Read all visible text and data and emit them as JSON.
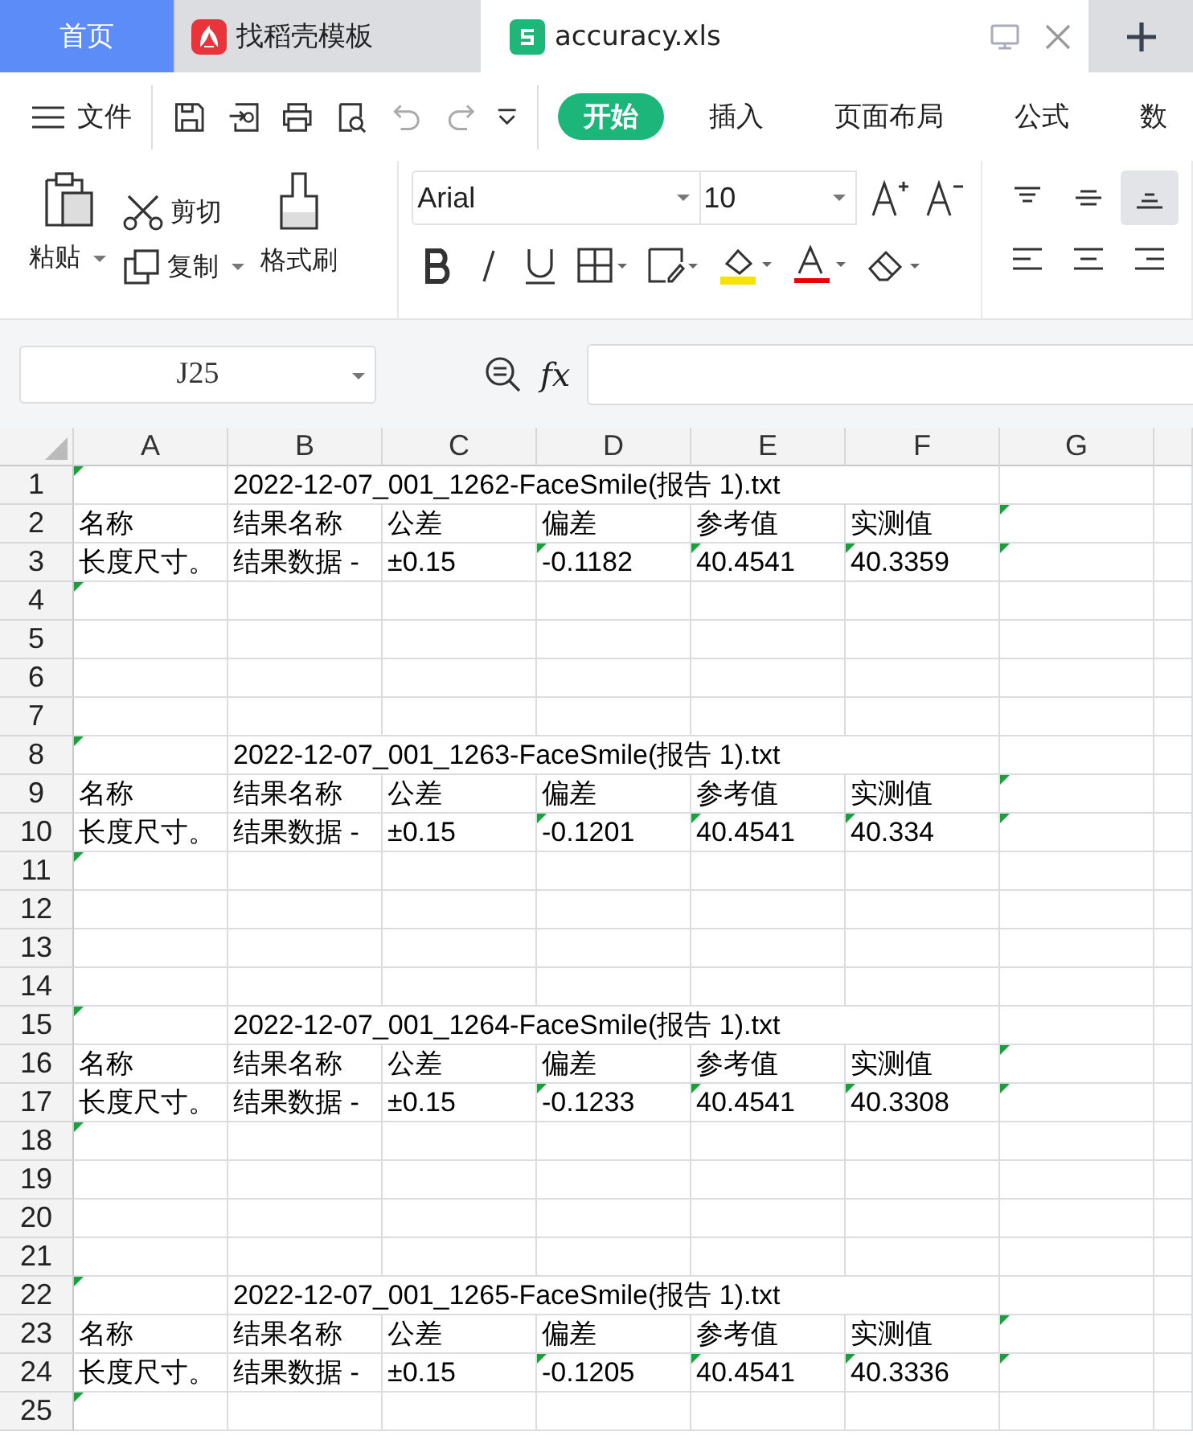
{
  "tabs": [
    {
      "label": "首页",
      "kind": "home",
      "selected": false
    },
    {
      "label": "找稻壳模板",
      "kind": "docer",
      "selected": false
    },
    {
      "label": "accuracy.xls",
      "kind": "sheet",
      "selected": true
    }
  ],
  "menu": {
    "file": "文件",
    "ribbon_tabs": [
      {
        "label": "开始",
        "selected": true
      },
      {
        "label": "插入",
        "selected": false
      },
      {
        "label": "页面布局",
        "selected": false
      },
      {
        "label": "公式",
        "selected": false
      },
      {
        "label": "数",
        "selected": false
      }
    ]
  },
  "ribbon": {
    "paste": "粘贴",
    "cut": "剪切",
    "copy": "复制",
    "format_painter": "格式刷",
    "font": "Arial",
    "font_size": "10",
    "align": [
      {
        "kind": "top",
        "selected": false
      },
      {
        "kind": "middle",
        "selected": false
      },
      {
        "kind": "bottom",
        "selected": true
      },
      {
        "kind": "left",
        "selected": false
      },
      {
        "kind": "center",
        "selected": false
      },
      {
        "kind": "right",
        "selected": false
      }
    ]
  },
  "formula_bar": {
    "name_box": "J25",
    "fx": "fx"
  },
  "columns": [
    "A",
    "B",
    "C",
    "D",
    "E",
    "F",
    "G"
  ],
  "rows": [
    {
      "number": "1",
      "cells": [
        {
          "marked": true
        },
        {
          "text": "2022-12-07_001_1262-FaceSmile(报告 1).txt",
          "kind": "title",
          "marked": false
        },
        {
          "marked": false
        }
      ]
    },
    {
      "number": "2",
      "cells": [
        {
          "text": "名称",
          "marked": false
        },
        {
          "text": "结果名称",
          "marked": false
        },
        {
          "text": "公差",
          "marked": false
        },
        {
          "text": "偏差",
          "marked": false
        },
        {
          "text": "参考值",
          "marked": false
        },
        {
          "text": "实测值",
          "marked": false
        },
        {
          "marked": true
        }
      ]
    },
    {
      "number": "3",
      "cells": [
        {
          "text": "长度尺寸。",
          "marked": false
        },
        {
          "text": "结果数据 -",
          "marked": false
        },
        {
          "text": "±0.15",
          "marked": false
        },
        {
          "text": "-0.1182",
          "marked": true
        },
        {
          "text": "40.4541",
          "marked": true
        },
        {
          "text": "40.3359",
          "marked": true
        },
        {
          "marked": true
        }
      ]
    },
    {
      "number": "4",
      "cells": [
        {
          "marked": true
        },
        {
          "marked": false
        },
        {
          "marked": false
        },
        {
          "marked": false
        },
        {
          "marked": false
        },
        {
          "marked": false
        },
        {
          "marked": false
        }
      ]
    },
    {
      "number": "5",
      "cells": []
    },
    {
      "number": "6",
      "cells": []
    },
    {
      "number": "7",
      "cells": []
    },
    {
      "number": "8",
      "cells": [
        {
          "marked": true
        },
        {
          "text": "2022-12-07_001_1263-FaceSmile(报告 1).txt",
          "kind": "title",
          "marked": false
        },
        {
          "marked": false
        }
      ]
    },
    {
      "number": "9",
      "cells": [
        {
          "text": "名称",
          "marked": false
        },
        {
          "text": "结果名称",
          "marked": false
        },
        {
          "text": "公差",
          "marked": false
        },
        {
          "text": "偏差",
          "marked": false
        },
        {
          "text": "参考值",
          "marked": false
        },
        {
          "text": "实测值",
          "marked": false
        },
        {
          "marked": true
        }
      ]
    },
    {
      "number": "10",
      "cells": [
        {
          "text": "长度尺寸。",
          "marked": false
        },
        {
          "text": "结果数据 -",
          "marked": false
        },
        {
          "text": "±0.15",
          "marked": false
        },
        {
          "text": "-0.1201",
          "marked": true
        },
        {
          "text": "40.4541",
          "marked": true
        },
        {
          "text": "40.334",
          "marked": true
        },
        {
          "marked": true
        }
      ]
    },
    {
      "number": "11",
      "cells": [
        {
          "marked": true
        },
        {
          "marked": false
        },
        {
          "marked": false
        },
        {
          "marked": false
        },
        {
          "marked": false
        },
        {
          "marked": false
        },
        {
          "marked": false
        }
      ]
    },
    {
      "number": "12",
      "cells": []
    },
    {
      "number": "13",
      "cells": []
    },
    {
      "number": "14",
      "cells": []
    },
    {
      "number": "15",
      "cells": [
        {
          "marked": true
        },
        {
          "text": "2022-12-07_001_1264-FaceSmile(报告 1).txt",
          "kind": "title",
          "marked": false
        },
        {
          "marked": false
        }
      ]
    },
    {
      "number": "16",
      "cells": [
        {
          "text": "名称",
          "marked": false
        },
        {
          "text": "结果名称",
          "marked": false
        },
        {
          "text": "公差",
          "marked": false
        },
        {
          "text": "偏差",
          "marked": false
        },
        {
          "text": "参考值",
          "marked": false
        },
        {
          "text": "实测值",
          "marked": false
        },
        {
          "marked": true
        }
      ]
    },
    {
      "number": "17",
      "cells": [
        {
          "text": "长度尺寸。",
          "marked": false
        },
        {
          "text": "结果数据 -",
          "marked": false
        },
        {
          "text": "±0.15",
          "marked": false
        },
        {
          "text": "-0.1233",
          "marked": true
        },
        {
          "text": "40.4541",
          "marked": true
        },
        {
          "text": "40.3308",
          "marked": true
        },
        {
          "marked": true
        }
      ]
    },
    {
      "number": "18",
      "cells": [
        {
          "marked": true
        },
        {
          "marked": false
        },
        {
          "marked": false
        },
        {
          "marked": false
        },
        {
          "marked": false
        },
        {
          "marked": false
        },
        {
          "marked": false
        }
      ]
    },
    {
      "number": "19",
      "cells": []
    },
    {
      "number": "20",
      "cells": []
    },
    {
      "number": "21",
      "cells": []
    },
    {
      "number": "22",
      "cells": [
        {
          "marked": true
        },
        {
          "text": "2022-12-07_001_1265-FaceSmile(报告 1).txt",
          "kind": "title",
          "marked": false
        },
        {
          "marked": false
        }
      ]
    },
    {
      "number": "23",
      "cells": [
        {
          "text": "名称",
          "marked": false
        },
        {
          "text": "结果名称",
          "marked": false
        },
        {
          "text": "公差",
          "marked": false
        },
        {
          "text": "偏差",
          "marked": false
        },
        {
          "text": "参考值",
          "marked": false
        },
        {
          "text": "实测值",
          "marked": false
        },
        {
          "marked": true
        }
      ]
    },
    {
      "number": "24",
      "cells": [
        {
          "text": "长度尺寸。",
          "marked": false
        },
        {
          "text": "结果数据 -",
          "marked": false
        },
        {
          "text": "±0.15",
          "marked": false
        },
        {
          "text": "-0.1205",
          "marked": true
        },
        {
          "text": "40.4541",
          "marked": true
        },
        {
          "text": "40.3336",
          "marked": true
        },
        {
          "marked": true
        }
      ]
    },
    {
      "number": "25",
      "cells": [
        {
          "marked": true
        },
        {
          "marked": false
        },
        {
          "marked": false
        },
        {
          "marked": false
        },
        {
          "marked": false
        },
        {
          "marked": false
        },
        {
          "marked": false
        }
      ]
    }
  ]
}
